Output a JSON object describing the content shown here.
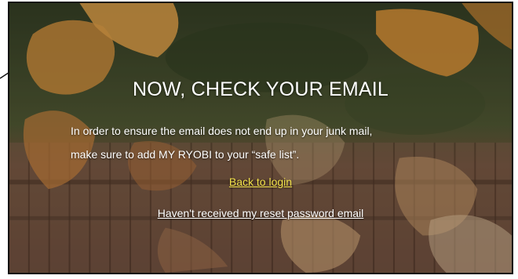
{
  "colors": {
    "heading": "#ffffff",
    "body_text": "#ffffff",
    "login_link": "#f2e24a",
    "resend_link": "#ffffff",
    "frame_border": "#111111"
  },
  "background": {
    "description_icon": "autumn-leaves-background"
  },
  "card": {
    "title": "NOW, CHECK YOUR EMAIL",
    "message_line1": "In order to ensure the email does not end up in your junk mail,",
    "message_line2": "make sure to add MY RYOBI to your “safe list”.",
    "back_to_login": "Back to login",
    "resend_link": "Haven't received my reset password email"
  }
}
